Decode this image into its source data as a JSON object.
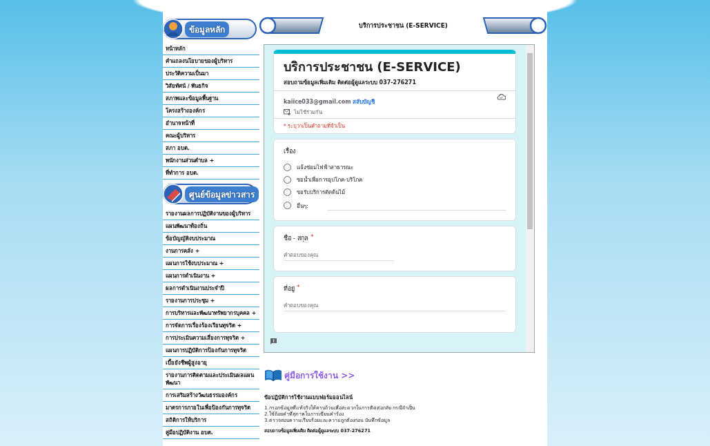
{
  "sidebar": {
    "sections": [
      {
        "heading": "ข้อมูลหลัก",
        "items": [
          {
            "label": "หน้าหลัก"
          },
          {
            "label": "คำแถลงนโยบายของผู้บริหาร"
          },
          {
            "label": "ประวัติความเป็นมา"
          },
          {
            "label": "วิสัยทัศน์ / พันธกิจ"
          },
          {
            "label": "สภาพและข้อมูลพื้นฐาน"
          },
          {
            "label": "โครงสร้างองค์กร"
          },
          {
            "label": "อำนาจหน้าที่"
          },
          {
            "label": "คณะผู้บริหาร"
          },
          {
            "label": "สภา อบต."
          },
          {
            "label": "พนักงานส่วนตำบล +"
          },
          {
            "label": "ที่ทำการ อบต."
          }
        ]
      },
      {
        "heading": "ศูนย์ข้อมูลข่าวสาร",
        "items": [
          {
            "label": "รายงานผลการปฏิบัติงานของผู้บริหาร"
          },
          {
            "label": "แผนพัฒนาท้องถิ่น"
          },
          {
            "label": "ข้อบัญญัติงบประมาณ"
          },
          {
            "label": "งานการคลัง +"
          },
          {
            "label": "แผนการใช้งบประมาณ +"
          },
          {
            "label": "แผนการดำเนินงาน +"
          },
          {
            "label": "ผลการดำเนินงานประจำปี"
          },
          {
            "label": "รายงานการประชุม +"
          },
          {
            "label": "การบริหารและพัฒนาทรัพยากรบุคคล +"
          },
          {
            "label": "การจัดการเรื่องร้องเรียนทุจริต +"
          },
          {
            "label": "การประเมินความเสี่ยงการทุจริต +"
          },
          {
            "label": "แผนการปฏิบัติการป้องกันการทุจริต"
          },
          {
            "label": "เบี้ยยังชีพผู้สูงอายุ"
          },
          {
            "label": "รายงานการติดตามและประเมินผลแผนพัฒนา"
          },
          {
            "label": "การเสริมสร้างวัฒนธรรมองค์กร"
          },
          {
            "label": "มาตรการภายในเพื่อป้องกันการทุจริต"
          },
          {
            "label": "สถิติการให้บริการ"
          },
          {
            "label": "คู่มือปฏิบัติงาน อบต."
          }
        ]
      }
    ]
  },
  "header": {
    "title": "บริการประชาชน (E-SERVICE)"
  },
  "form": {
    "title": "บริการประชาชน (E-SERVICE)",
    "description": "สอบถามข้อมูลเพิ่มเติม ติดต่อผู้ดูแลระบบ  037-276271",
    "account": {
      "email": "kaiice033@gmail.com",
      "switch_link": "สลับบัญชี",
      "not_shared": "ไม่ใช้ร่วมกัน"
    },
    "required_note": "* ระบุว่าเป็นคำถามที่จำเป็น",
    "questions": [
      {
        "kind": "radio",
        "title": "เรื่อง",
        "options": [
          {
            "kind": "plain",
            "label": "แจ้งซ่อมไฟฟ้าสาธารณะ",
            "selected": false
          },
          {
            "kind": "plain",
            "label": "ขอน้ำเพื่อการอุปโภค-บริโภค",
            "selected": false
          },
          {
            "kind": "plain",
            "label": "ขอรับบริการตัดต้นไม้",
            "selected": false
          },
          {
            "kind": "other",
            "label": "อื่นๆ:",
            "selected": false
          }
        ]
      },
      {
        "kind": "short",
        "title": "ชื่อ - สกุล",
        "required_mark": "*",
        "placeholder": "คำตอบของคุณ"
      },
      {
        "kind": "long",
        "title": "ที่อยู่",
        "required_mark": "*",
        "placeholder": "คำตอบของคุณ"
      }
    ]
  },
  "guide": {
    "link": "คู่มือการใช้งาน >>",
    "heading": "ข้อปฏิบัติการใช้งานแบบฟอร์มออนไลน์",
    "steps": [
      "1.กรอกข้อมูลที่แท้จริงให้ครบถ้วนเพื่อสะดวกในการติดต่อกลับ กรณีจำเป็น",
      "2.ใช้ถ้อยคำที่สุภาพในการเขียนคำร้อง",
      "3.ตรวจสอบความเรียบร้อยและความถูกต้องก่อน บันทึกข้อมูล"
    ],
    "contact": "สอบถามข้อมูลเพิ่มเติม ติดต่อผู้ดูแลระบบ  037-276271"
  }
}
